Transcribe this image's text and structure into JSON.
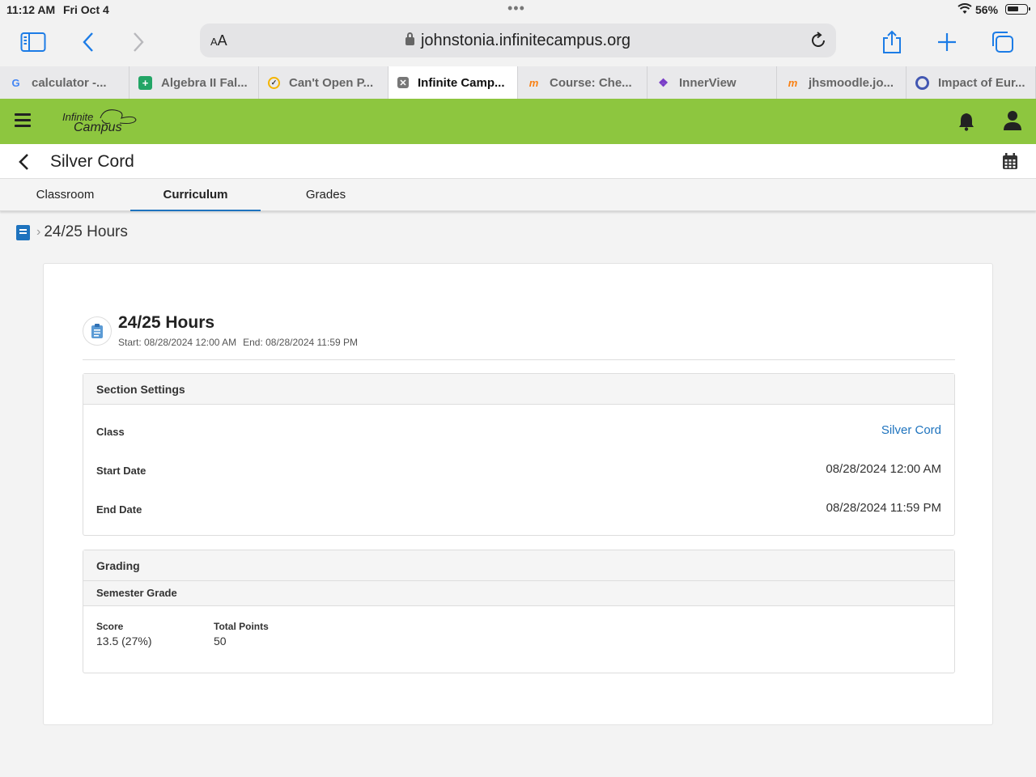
{
  "status": {
    "time": "11:12 AM",
    "date": "Fri Oct 4",
    "battery": "56%"
  },
  "browser": {
    "address": {
      "aa_small": "A",
      "aa_big": "A",
      "url": "johnstonia.infinitecampus.org"
    },
    "tabs": [
      {
        "label": "calculator -...",
        "favicon": "google-icon",
        "color": "#4285f4"
      },
      {
        "label": "Algebra II Fal...",
        "favicon": "sheets-icon",
        "color": "#23a566"
      },
      {
        "label": "Can't Open P...",
        "favicon": "clock-icon",
        "color": "#f4b400"
      },
      {
        "label": "Infinite Camp...",
        "favicon": "close-tab-icon",
        "color": "#666666"
      },
      {
        "label": "Course: Che...",
        "favicon": "moodle-icon",
        "color": "#f98012"
      },
      {
        "label": "InnerView",
        "favicon": "innerview-icon",
        "color": "#7a3ec8"
      },
      {
        "label": "jhsmoodle.jo...",
        "favicon": "moodle-icon",
        "color": "#f98012"
      },
      {
        "label": "Impact of Eur...",
        "favicon": "quizlet-icon",
        "color": "#4257b2"
      }
    ]
  },
  "app": {
    "brand_color": "#8dc63f",
    "logo_line1": "Infinite",
    "logo_line2": "Campus",
    "page_title": "Silver Cord",
    "subtabs": [
      "Classroom",
      "Curriculum",
      "Grades"
    ],
    "active_subtab": "Curriculum",
    "breadcrumb": "24/25 Hours"
  },
  "assignment": {
    "title": "24/25 Hours",
    "start": "Start: 08/28/2024 12:00 AM",
    "end": "End: 08/28/2024 11:59 PM"
  },
  "section_settings": {
    "heading": "Section Settings",
    "rows": [
      {
        "label": "Class",
        "value": "Silver Cord"
      },
      {
        "label": "Start Date",
        "value": "08/28/2024 12:00 AM"
      },
      {
        "label": "End Date",
        "value": "08/28/2024 11:59 PM"
      }
    ]
  },
  "grading": {
    "heading": "Grading",
    "subheading": "Semester Grade",
    "score_label": "Score",
    "score_value": "13.5 (27%)",
    "points_label": "Total Points",
    "points_value": "50"
  }
}
